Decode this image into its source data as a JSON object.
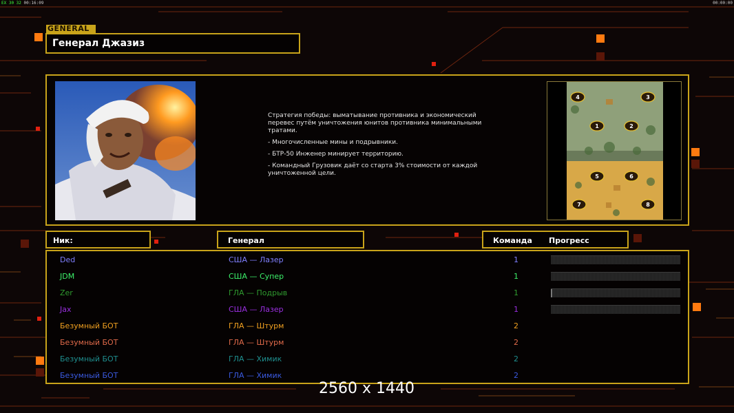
{
  "hud": {
    "left": "00:16:09",
    "left_small": "EX 30 32",
    "right": "00:00:00"
  },
  "general_tag": "GENERAL",
  "general_name": "Генерал Джазиз",
  "description": [
    "Стратегия победы: выматывание противника и экономический\n перевес путём уничтожения юнитов противника минимальными\n тратами.",
    "- Многочисленные мины и подрывники.",
    "- БТР-50 Инженер минирует территорию.",
    "- Командный Грузовик даёт со старта 3% стоимости от каждой\n уничтоженной цели."
  ],
  "columns": {
    "nick": "Ник:",
    "general": "Генерал",
    "team": "Команда",
    "progress": "Прогресс"
  },
  "players": [
    {
      "nick": "Ded",
      "general": "США — Лазер",
      "team": "1",
      "color": "#7f7fff",
      "progress": 0.0
    },
    {
      "nick": "JDM",
      "general": "США — Супер",
      "team": "1",
      "color": "#3cf06a",
      "progress": 0.0
    },
    {
      "nick": "Zer",
      "general": "ГЛА — Подрыв",
      "team": "1",
      "color": "#2f9a2f",
      "progress": 0.01
    },
    {
      "nick": "Jax",
      "general": "США — Лазер",
      "team": "1",
      "color": "#9a2fe0",
      "progress": 0.0
    },
    {
      "nick": "Безумный БОТ",
      "general": "ГЛА — Штурм",
      "team": "2",
      "color": "#f0a020",
      "progress": null
    },
    {
      "nick": "Безумный БОТ",
      "general": "ГЛА — Штурм",
      "team": "2",
      "color": "#e06a4a",
      "progress": null
    },
    {
      "nick": "Безумный БОТ",
      "general": "ГЛА — Химик",
      "team": "2",
      "color": "#1f8f8f",
      "progress": null
    },
    {
      "nick": "Безумный БОТ",
      "general": "ГЛА — Химик",
      "team": "2",
      "color": "#3a5ae0",
      "progress": null
    }
  ],
  "minimap_slots": [
    "4",
    "3",
    "1",
    "2",
    "5",
    "6",
    "7",
    "8"
  ],
  "resolution_label": "2560 x 1440",
  "colors": {
    "accent": "#c9a41a",
    "hud_orange": "#ff7a10"
  }
}
